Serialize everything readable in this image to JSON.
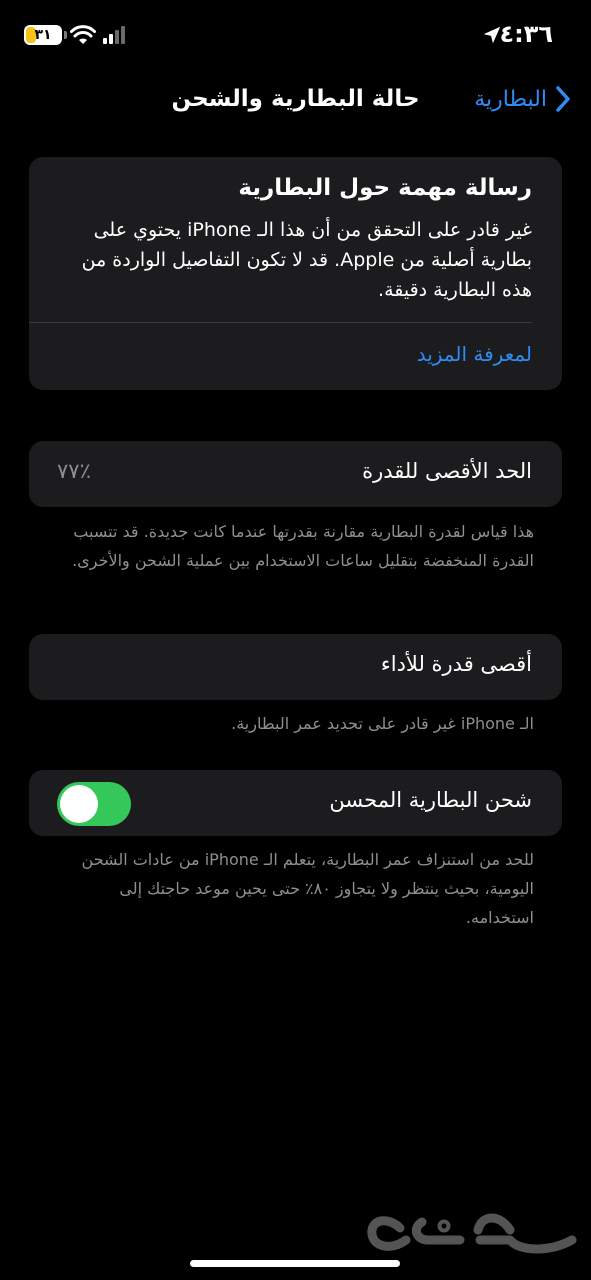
{
  "status_bar": {
    "time": "٤:٣٦",
    "battery_level": "٣١",
    "battery_color": "#f7c21a",
    "icons": [
      "location-arrow-icon",
      "wifi-icon",
      "cellular-signal-icon",
      "battery-icon"
    ]
  },
  "nav": {
    "title": "حالة البطارية والشحن",
    "back_label": "البطارية",
    "back_icon": "chevron-right-icon"
  },
  "message_card": {
    "title": "رسالة مهمة حول البطارية",
    "body": "غير قادر على التحقق من أن هذا الـ iPhone يحتوي على بطارية أصلية من Apple. قد لا تكون التفاصيل الواردة من هذه البطارية دقيقة.",
    "link": "لمعرفة المزيد"
  },
  "max_capacity": {
    "label": "الحد الأقصى للقدرة",
    "value": "٪٧٧",
    "footnote": "هذا قياس لقدرة البطارية مقارنة بقدرتها عندما كانت جديدة. قد تتسبب القدرة المنخفضة بتقليل ساعات الاستخدام بين عملية الشحن والأخرى."
  },
  "peak_performance": {
    "label": "أقصى قدرة للأداء",
    "footnote": "الـ iPhone غير قادر على تحديد عمر البطارية."
  },
  "optimized_charging": {
    "label": "شحن البطارية المحسن",
    "enabled": true,
    "footnote": "للحد من استنزاف عمر البطارية، يتعلم الـ iPhone من عادات الشحن اليومية، بحيث ينتظر ولا يتجاوز ٨٠٪ حتى يحين موعد حاجتك إلى استخدامه."
  },
  "colors": {
    "background": "#000000",
    "card": "#1c1c1e",
    "accent": "#2f8cf5",
    "toggle_on": "#34c759",
    "secondary_text": "#8e8e93"
  },
  "watermark": "حراج"
}
